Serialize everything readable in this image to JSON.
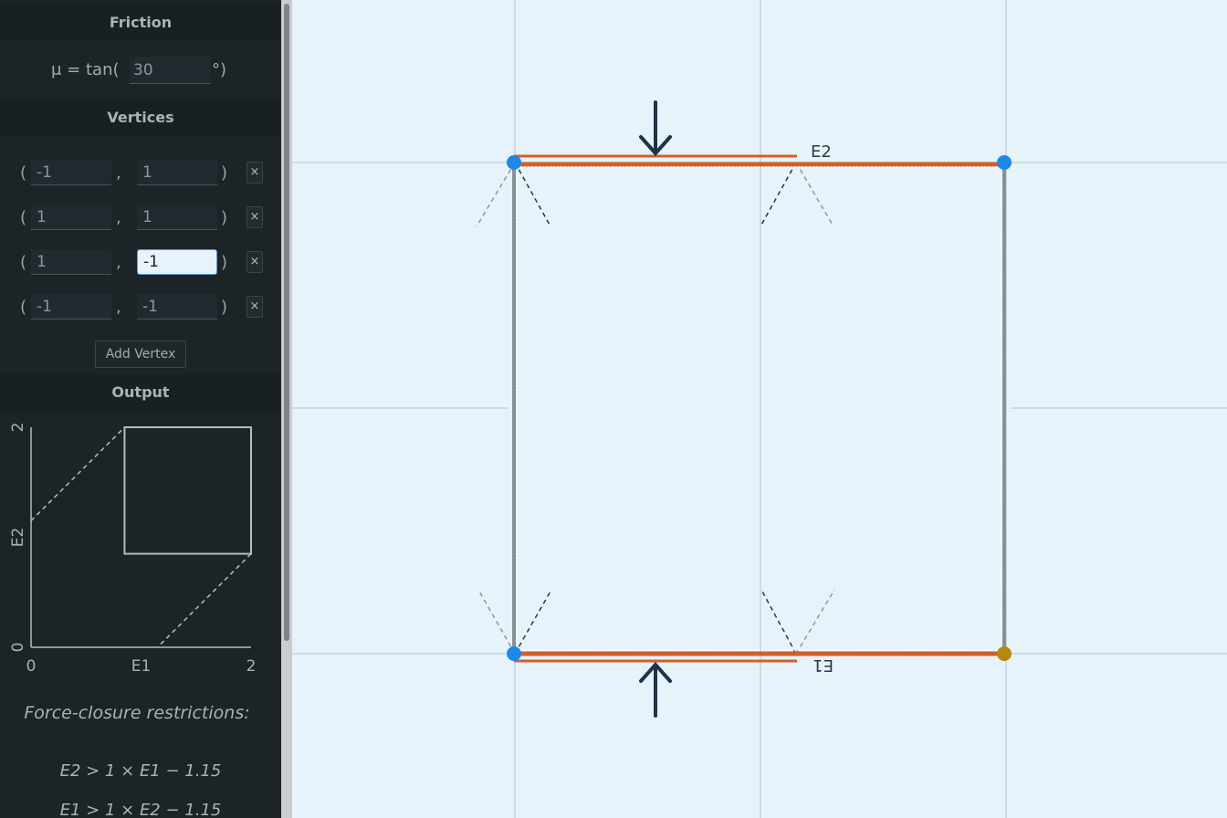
{
  "friction": {
    "section_title": "Friction",
    "mu_label": "μ = tan(",
    "angle_value": "30",
    "mu_suffix": "°)"
  },
  "vertices": {
    "section_title": "Vertices",
    "items": [
      {
        "x": "-1",
        "y": "1"
      },
      {
        "x": "1",
        "y": "1"
      },
      {
        "x": "1",
        "y": "-1"
      },
      {
        "x": "-1",
        "y": "-1"
      }
    ],
    "delete_label": "×",
    "add_label": "Add Vertex"
  },
  "output": {
    "section_title": "Output",
    "chart_data": {
      "type": "line",
      "xlabel": "E1",
      "ylabel": "E2",
      "xlim": [
        0,
        2
      ],
      "ylim": [
        0,
        2
      ],
      "x_ticks": [
        "0",
        "E1",
        "2"
      ],
      "y_ticks": [
        "0",
        "E2",
        "2"
      ],
      "region_rect": {
        "x0": 0.85,
        "x1": 2,
        "y0": 0.85,
        "y1": 2
      },
      "restriction_lines": [
        {
          "name": "E2 > 1 × E1 − 1.15",
          "slope": 1,
          "intercept": -1.15
        },
        {
          "name": "E1 > 1 × E2 − 1.15",
          "slope": 1,
          "intercept": 1.15
        }
      ]
    }
  },
  "restrictions": {
    "title": "Force-closure restrictions:",
    "equations": [
      "E2 > 1 × E1 − 1.15",
      "E1 > 1 × E2 − 1.15"
    ]
  },
  "scene": {
    "edge_labels": {
      "top": "E2",
      "bottom": "E1"
    },
    "colors": {
      "background": "#e6f3fb",
      "grid": "#c5d3dc",
      "edge_active": "#d35f28",
      "edge_inactive": "#8a9196",
      "vertex": "#1e88e5",
      "vertex_selected": "#b38a10",
      "arrow": "#1f3447"
    }
  }
}
